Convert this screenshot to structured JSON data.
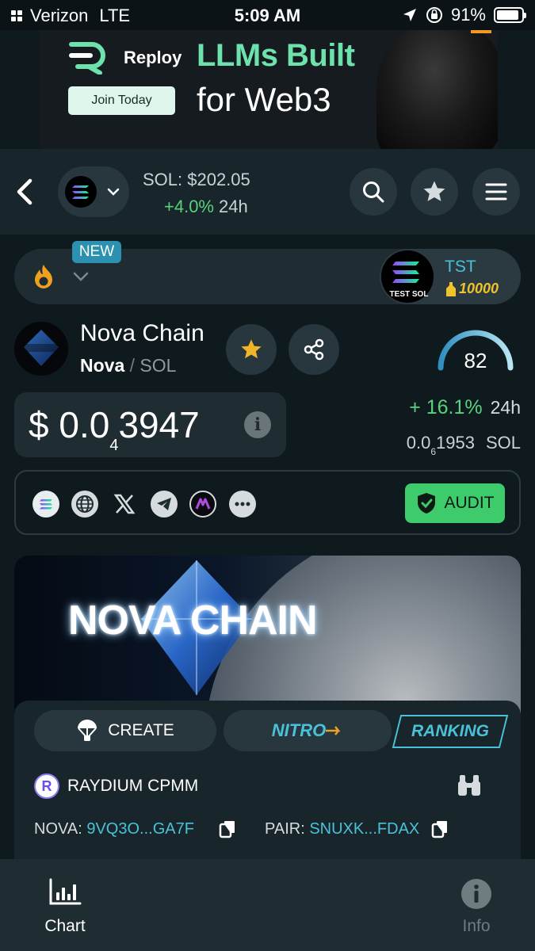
{
  "status_bar": {
    "carrier": "Verizon",
    "network": "LTE",
    "time": "5:09 AM",
    "battery": "91%",
    "battery_level": 0.91
  },
  "ad": {
    "brand": "Reploy",
    "cta": "Join Today",
    "headline_line1": "LLMs Built",
    "headline_line2": "for Web3",
    "accent_color": "#6ee2ad"
  },
  "header": {
    "price_label": "SOL: $202.05",
    "change": "+4.0%",
    "change_period": "24h"
  },
  "promo": {
    "badge": "NEW",
    "tst_name": "TST",
    "tst_amount": "10000",
    "tst_logo_text": "TEST SOL"
  },
  "token": {
    "name": "Nova Chain",
    "symbol": "Nova",
    "separator": "/",
    "quote": "SOL",
    "score": "82",
    "score_value": 82,
    "price_prefix": "$ 0.0",
    "price_zeros": "4",
    "price_digits": "3947",
    "change": "+ 16.1%",
    "change_period": "24h",
    "sol_price_prefix": "0.0",
    "sol_price_zeros": "6",
    "sol_price_digits": "1953",
    "sol_unit": "SOL"
  },
  "links": {
    "icons": [
      "solana-icon",
      "globe-icon",
      "x-icon",
      "telegram-icon",
      "token-app-icon",
      "more-icon"
    ],
    "audit_label": "AUDIT"
  },
  "banner": {
    "title": "NOVA CHAIN"
  },
  "actions": {
    "create_label": "CREATE",
    "nitro_label": "NITRO",
    "ranking_label": "RANKING"
  },
  "dex": {
    "name": "RAYDIUM CPMM",
    "logo_letter": "R",
    "token_label": "NOVA:",
    "token_address": "9VQ3O...GA7F",
    "pair_label": "PAIR:",
    "pair_address": "SNUXK...FDAX"
  },
  "tabbar": {
    "chart_label": "Chart",
    "info_label": "Info"
  },
  "colors": {
    "background": "#0f1a1e",
    "positive": "#58d27d",
    "accent_cyan": "#4bc1d9",
    "audit_green": "#3dcb6c",
    "star_gold": "#f0b429"
  }
}
